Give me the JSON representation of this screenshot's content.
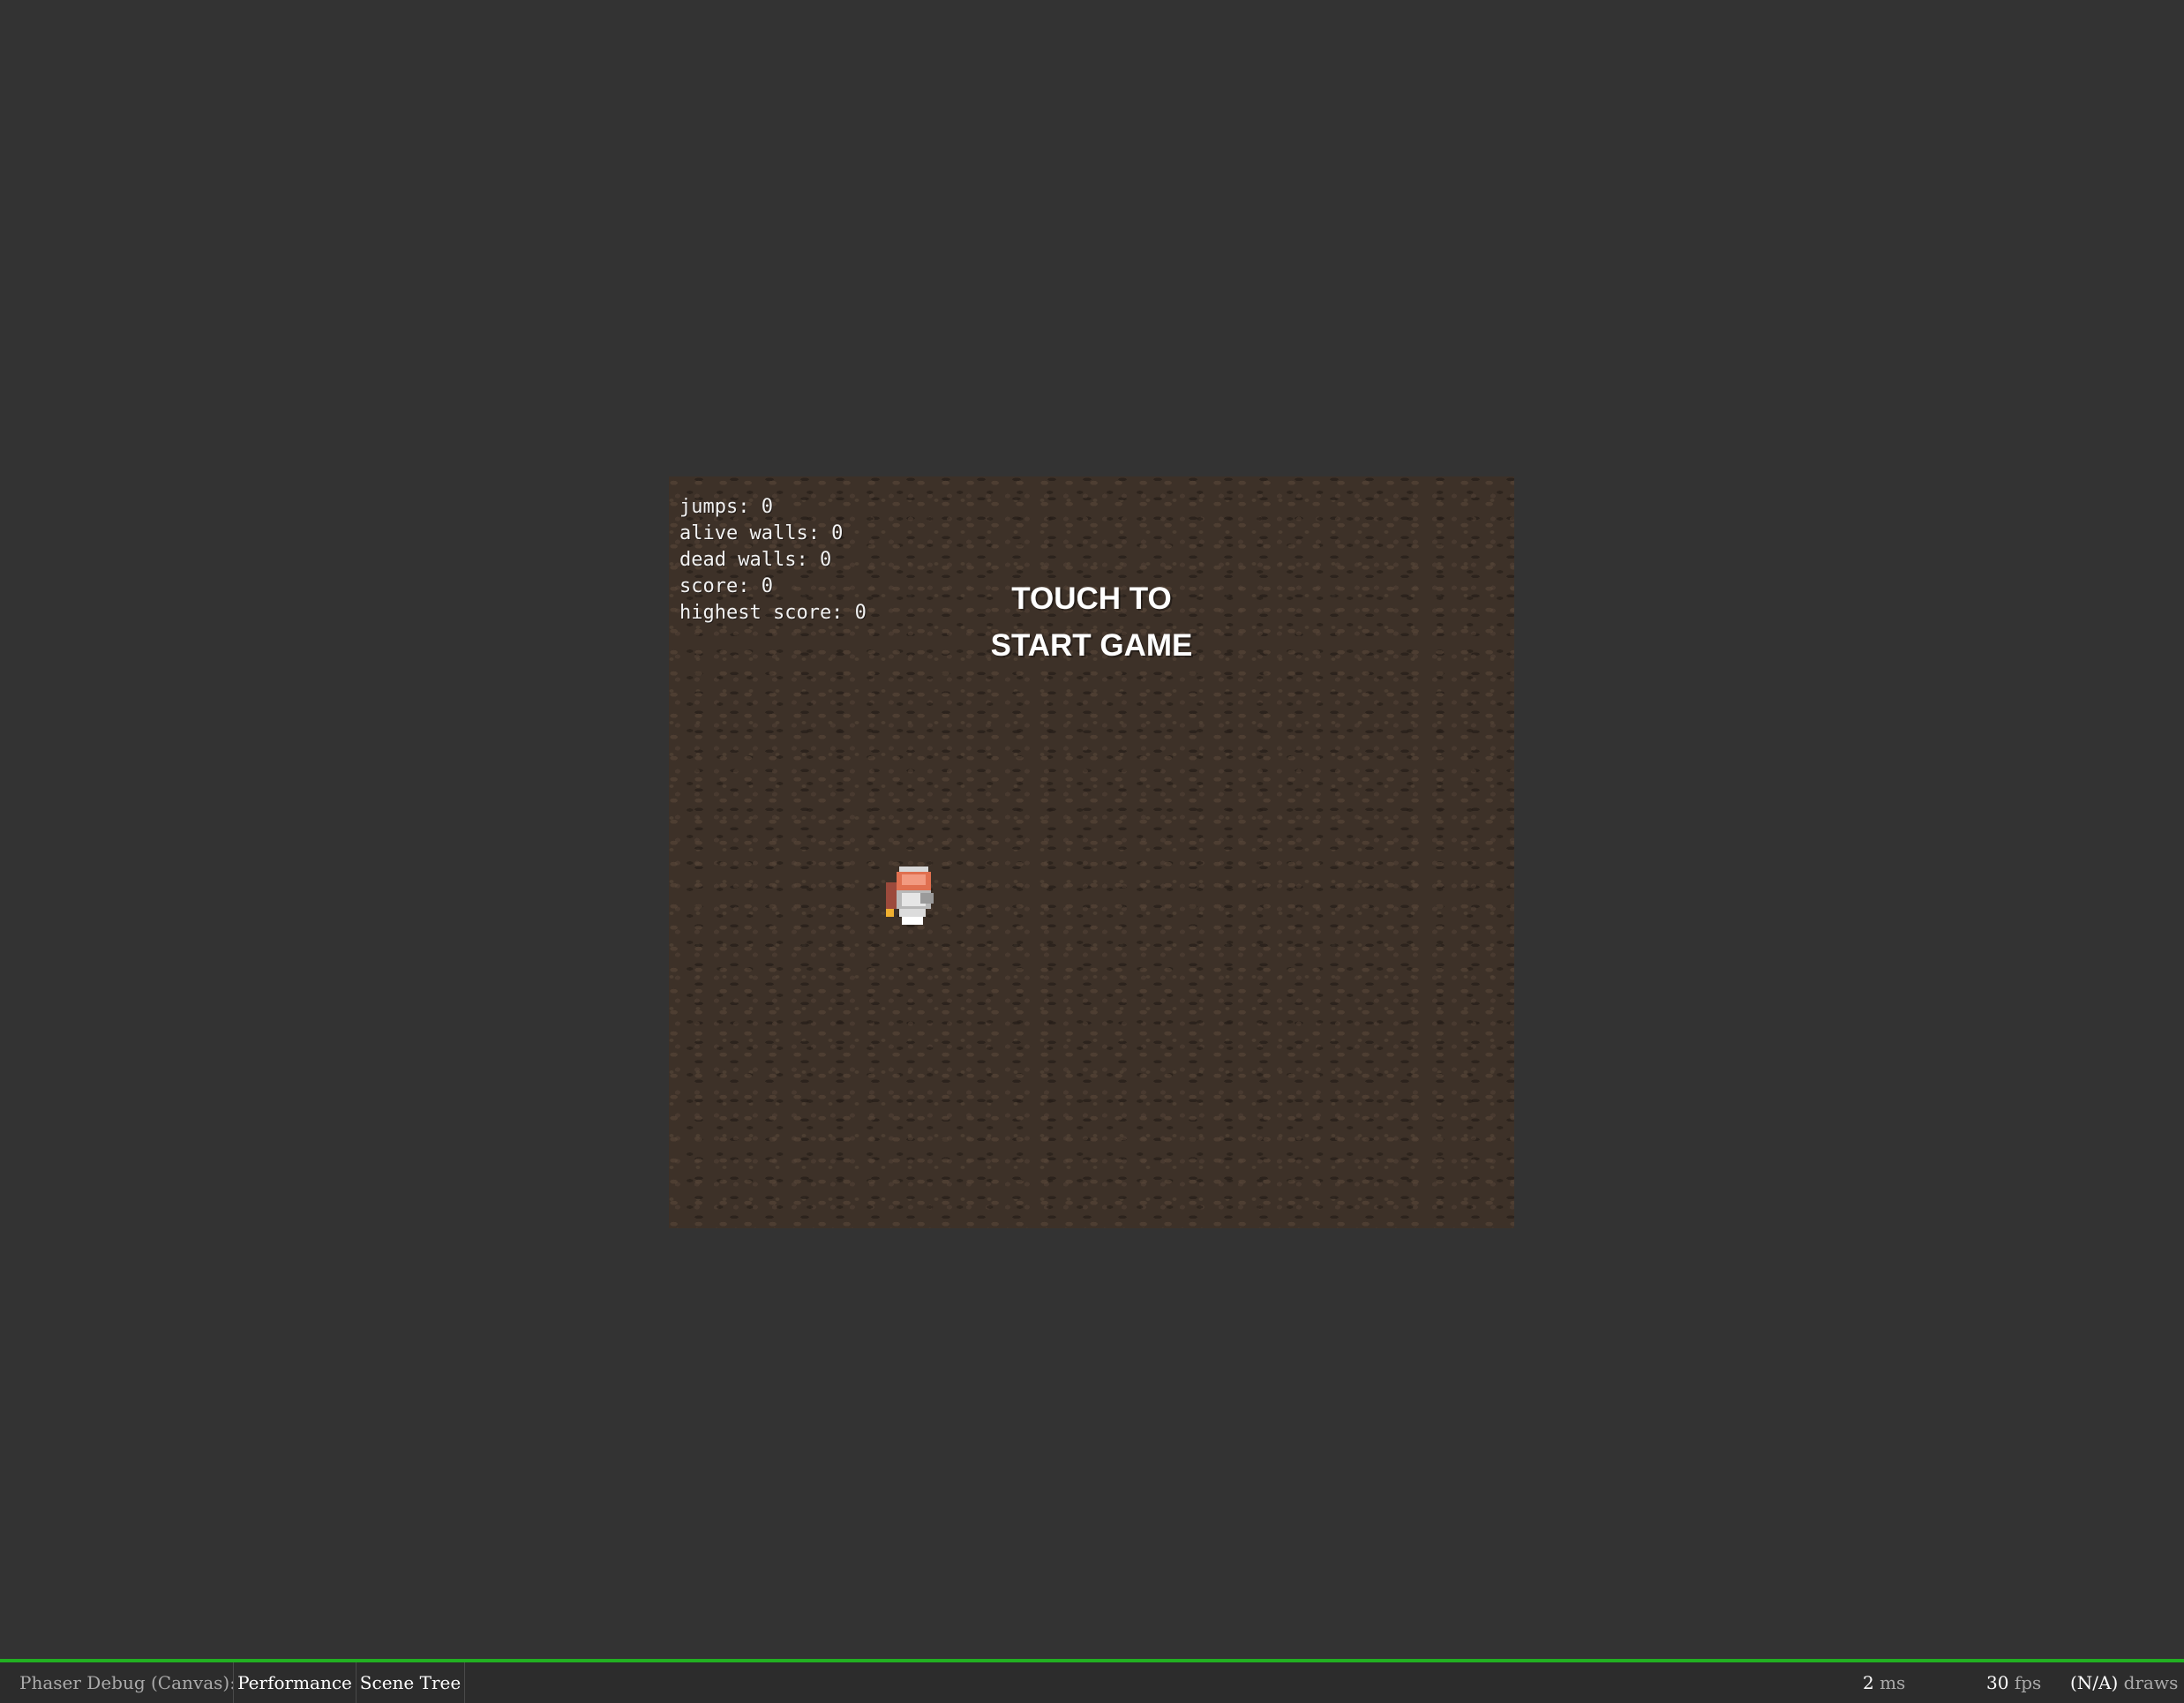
{
  "game": {
    "stats": {
      "jumps": "jumps: 0",
      "alive_walls": "alive walls: 0",
      "dead_walls": "dead walls: 0",
      "score": "score: 0",
      "highest_score": "highest score: 0"
    },
    "prompt": {
      "line1": "TOUCH TO",
      "line2": "START GAME"
    },
    "player_sprite": "astronaut-jetpack-sprite"
  },
  "debug_bar": {
    "title": "Phaser Debug (Canvas):",
    "tabs": [
      "Performance",
      "Scene Tree"
    ],
    "metrics": {
      "ms_value": "2",
      "ms_unit": "ms",
      "fps_value": "30",
      "fps_unit": "fps",
      "draws_value": "(N/A)",
      "draws_unit": "draws"
    },
    "accent_color": "#22b022"
  },
  "colors": {
    "page_background": "#333333",
    "game_background": "#3d3128"
  }
}
